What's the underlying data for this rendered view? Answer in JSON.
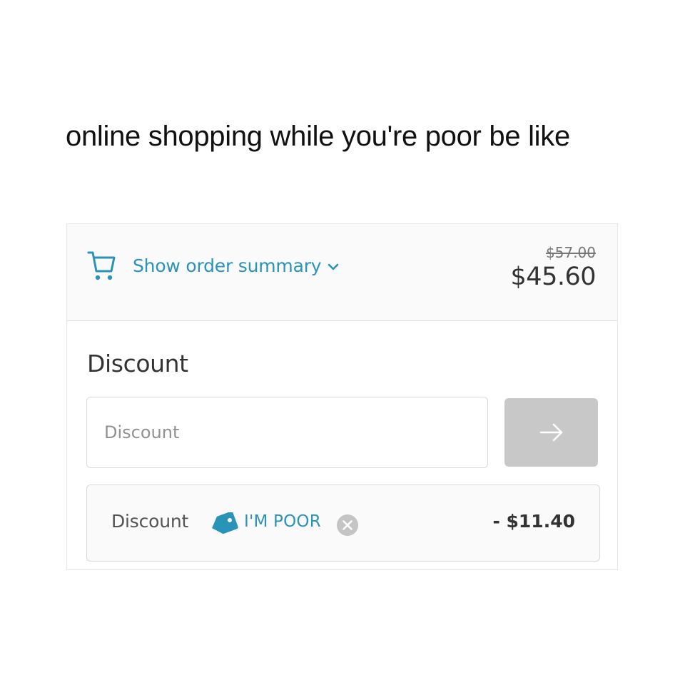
{
  "caption": {
    "text": "online shopping while you're poor be like"
  },
  "order_summary": {
    "toggle_label": "Show order summary",
    "icon": "cart-icon",
    "expand_icon": "chevron-down-icon",
    "original_total": "$57.00",
    "discounted_total": "$45.60"
  },
  "discount": {
    "heading": "Discount",
    "input_placeholder": "Discount",
    "input_value": "",
    "apply_icon": "arrow-right-icon",
    "applied": {
      "label": "Discount",
      "tag_icon": "tag-icon",
      "code": "I'M POOR",
      "remove_icon": "close-circle-icon",
      "amount": "- $11.40"
    }
  },
  "colors": {
    "accent": "#2a93b8",
    "apply_button_disabled": "#c8c8c8",
    "summary_background": "#fafafa",
    "border": "#d9d9d9"
  }
}
